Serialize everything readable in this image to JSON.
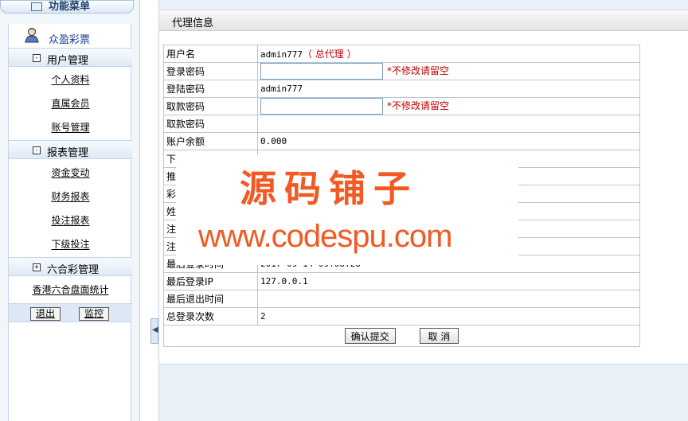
{
  "sidebar": {
    "header_title": "功能菜单",
    "brand": "众盈彩票",
    "groups": [
      {
        "label": "用户管理",
        "box": "-",
        "items": [
          "个人资料",
          "直属会员",
          "账号管理"
        ]
      },
      {
        "label": "报表管理",
        "box": "-",
        "items": [
          "资金变动",
          "财务报表",
          "投注报表",
          "下级投注"
        ]
      },
      {
        "label": "六合彩管理",
        "box": "+",
        "items": []
      }
    ],
    "hk_stat": "香港六合盘面统计",
    "logout": "退出",
    "monitor": "监控",
    "splitter_icon": "chevron-left-icon"
  },
  "main": {
    "title": "代理信息",
    "rows": [
      {
        "label": "用户名",
        "value": "admin777",
        "role": "（ 总代理 ）"
      },
      {
        "label": "登录密码",
        "input": true,
        "hint": "*不修改请留空"
      },
      {
        "label": "登陆密码",
        "value": "admin777"
      },
      {
        "label": "取款密码",
        "input": true,
        "hint": "*不修改请留空"
      },
      {
        "label": "取款密码",
        "value": ""
      },
      {
        "label": "账户余额",
        "value": "0.000"
      },
      {
        "label": "下",
        "value": ""
      },
      {
        "label": "推",
        "value": ""
      },
      {
        "label": "彩",
        "value": ""
      },
      {
        "label": "姓",
        "value": ""
      },
      {
        "label": "注",
        "value": ""
      },
      {
        "label": "注",
        "value": ""
      },
      {
        "label": "最后登录时间",
        "value": "2017-09-14 09:08:28"
      },
      {
        "label": "最后登录IP",
        "value": "127.0.0.1"
      },
      {
        "label": "最后退出时间",
        "value": ""
      },
      {
        "label": "总登录次数",
        "value": "2"
      }
    ],
    "submit": "确认提交",
    "cancel": "取 消"
  },
  "watermark": {
    "cn": "源码铺子",
    "url": "www.codespu.com"
  },
  "colors": {
    "accent_red": "#c00000",
    "watermark_orange": "#f15a22",
    "sidebar_blue": "#1a3a9a"
  }
}
